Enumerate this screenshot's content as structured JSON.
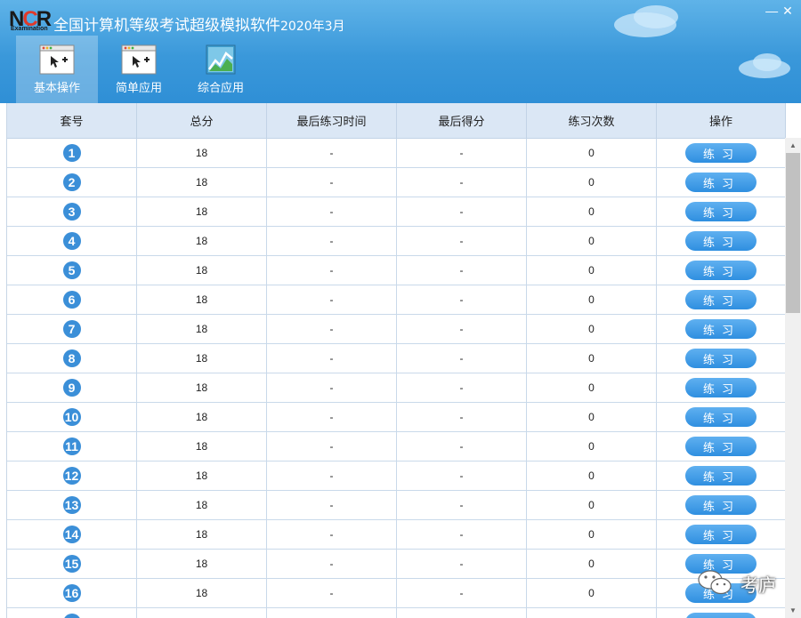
{
  "app": {
    "logo_text": "NCR",
    "logo_sub": "Examination",
    "title": "全国计算机等级考试超级模拟软件",
    "version": "2020年3月"
  },
  "window": {
    "minimize": "—",
    "close": "✕"
  },
  "toolbar": [
    {
      "label": "基本操作",
      "icon": "basic-operation-icon",
      "active": true
    },
    {
      "label": "简单应用",
      "icon": "simple-app-icon",
      "active": false
    },
    {
      "label": "综合应用",
      "icon": "comprehensive-app-icon",
      "active": false
    }
  ],
  "table": {
    "headers": [
      "套号",
      "总分",
      "最后练习时间",
      "最后得分",
      "练习次数",
      "操作"
    ],
    "rows": [
      {
        "no": "1",
        "score": "18",
        "last_time": "-",
        "last_score": "-",
        "count": "0",
        "action": "练习"
      },
      {
        "no": "2",
        "score": "18",
        "last_time": "-",
        "last_score": "-",
        "count": "0",
        "action": "练习"
      },
      {
        "no": "3",
        "score": "18",
        "last_time": "-",
        "last_score": "-",
        "count": "0",
        "action": "练习"
      },
      {
        "no": "4",
        "score": "18",
        "last_time": "-",
        "last_score": "-",
        "count": "0",
        "action": "练习"
      },
      {
        "no": "5",
        "score": "18",
        "last_time": "-",
        "last_score": "-",
        "count": "0",
        "action": "练习"
      },
      {
        "no": "6",
        "score": "18",
        "last_time": "-",
        "last_score": "-",
        "count": "0",
        "action": "练习"
      },
      {
        "no": "7",
        "score": "18",
        "last_time": "-",
        "last_score": "-",
        "count": "0",
        "action": "练习"
      },
      {
        "no": "8",
        "score": "18",
        "last_time": "-",
        "last_score": "-",
        "count": "0",
        "action": "练习"
      },
      {
        "no": "9",
        "score": "18",
        "last_time": "-",
        "last_score": "-",
        "count": "0",
        "action": "练习"
      },
      {
        "no": "10",
        "score": "18",
        "last_time": "-",
        "last_score": "-",
        "count": "0",
        "action": "练习"
      },
      {
        "no": "11",
        "score": "18",
        "last_time": "-",
        "last_score": "-",
        "count": "0",
        "action": "练习"
      },
      {
        "no": "12",
        "score": "18",
        "last_time": "-",
        "last_score": "-",
        "count": "0",
        "action": "练习"
      },
      {
        "no": "13",
        "score": "18",
        "last_time": "-",
        "last_score": "-",
        "count": "0",
        "action": "练习"
      },
      {
        "no": "14",
        "score": "18",
        "last_time": "-",
        "last_score": "-",
        "count": "0",
        "action": "练习"
      },
      {
        "no": "15",
        "score": "18",
        "last_time": "-",
        "last_score": "-",
        "count": "0",
        "action": "练习"
      },
      {
        "no": "16",
        "score": "18",
        "last_time": "-",
        "last_score": "-",
        "count": "0",
        "action": "练习"
      },
      {
        "no": "",
        "score": "",
        "last_time": "",
        "last_score": "",
        "count": "",
        "action": ""
      }
    ]
  },
  "watermark": {
    "text": "考庐",
    "icon": "wechat-icon"
  },
  "colors": {
    "header": "#3a98da",
    "table_header": "#dbe7f5",
    "accent": "#3b8fd8"
  }
}
